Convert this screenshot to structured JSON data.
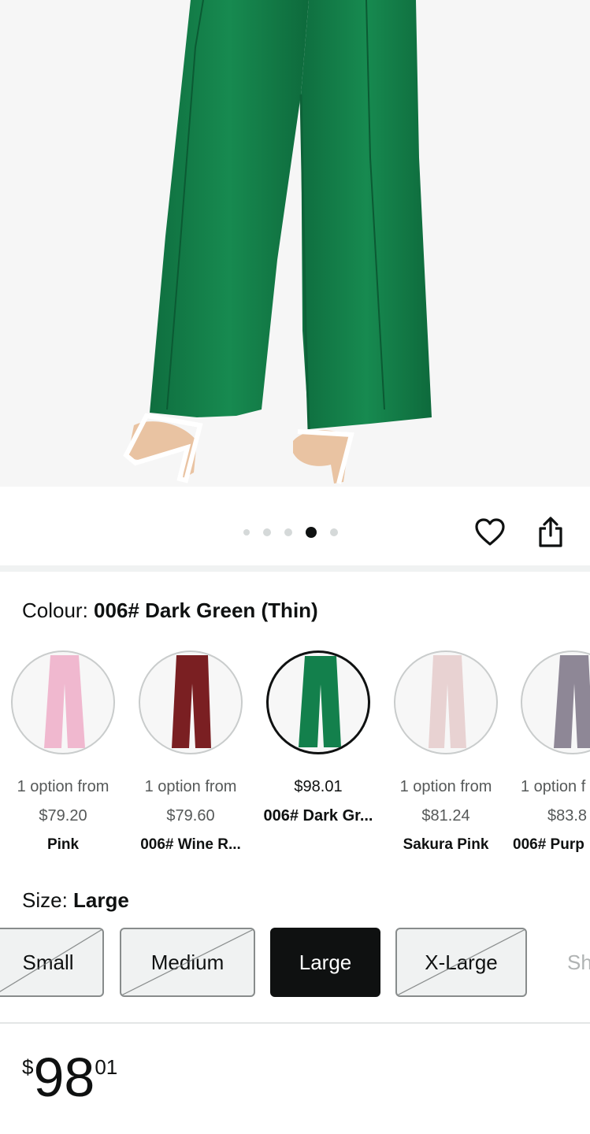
{
  "product_image": {
    "gallery_dots": 5,
    "active_index": 3
  },
  "actions": {
    "wishlist_icon": "heart-icon",
    "share_icon": "share-icon"
  },
  "colour": {
    "label": "Colour: ",
    "selected": "006# Dark Green (Thin)",
    "options": [
      {
        "line1": "1 option from",
        "line2": "$79.20",
        "name": "Pink",
        "color": "#f0b8cf"
      },
      {
        "line1": "1 option from",
        "line2": "$79.60",
        "name": "006# Wine R...",
        "color": "#7a1f22"
      },
      {
        "line1": "$98.01",
        "line2": "006# Dark Gr...",
        "name": "",
        "color": "#13804c"
      },
      {
        "line1": "1 option from",
        "line2": "$81.24",
        "name": "Sakura Pink",
        "color": "#e8d2d2"
      },
      {
        "line1": "1 option f",
        "line2": "$83.8",
        "name": "006# Purp",
        "color": "#8e8796"
      }
    ]
  },
  "size": {
    "label": "Size: ",
    "selected": "Large",
    "options": [
      {
        "label": "Small",
        "state": "unavailable"
      },
      {
        "label": "Medium",
        "state": "unavailable"
      },
      {
        "label": "Large",
        "state": "selected"
      },
      {
        "label": "X-Large",
        "state": "unavailable"
      },
      {
        "label": "Sh",
        "state": "more"
      }
    ]
  },
  "price": {
    "symbol": "$",
    "whole": "98",
    "fraction": "01"
  },
  "colors": {
    "text": "#0f1111",
    "muted": "#565959",
    "product_green": "#138049"
  }
}
